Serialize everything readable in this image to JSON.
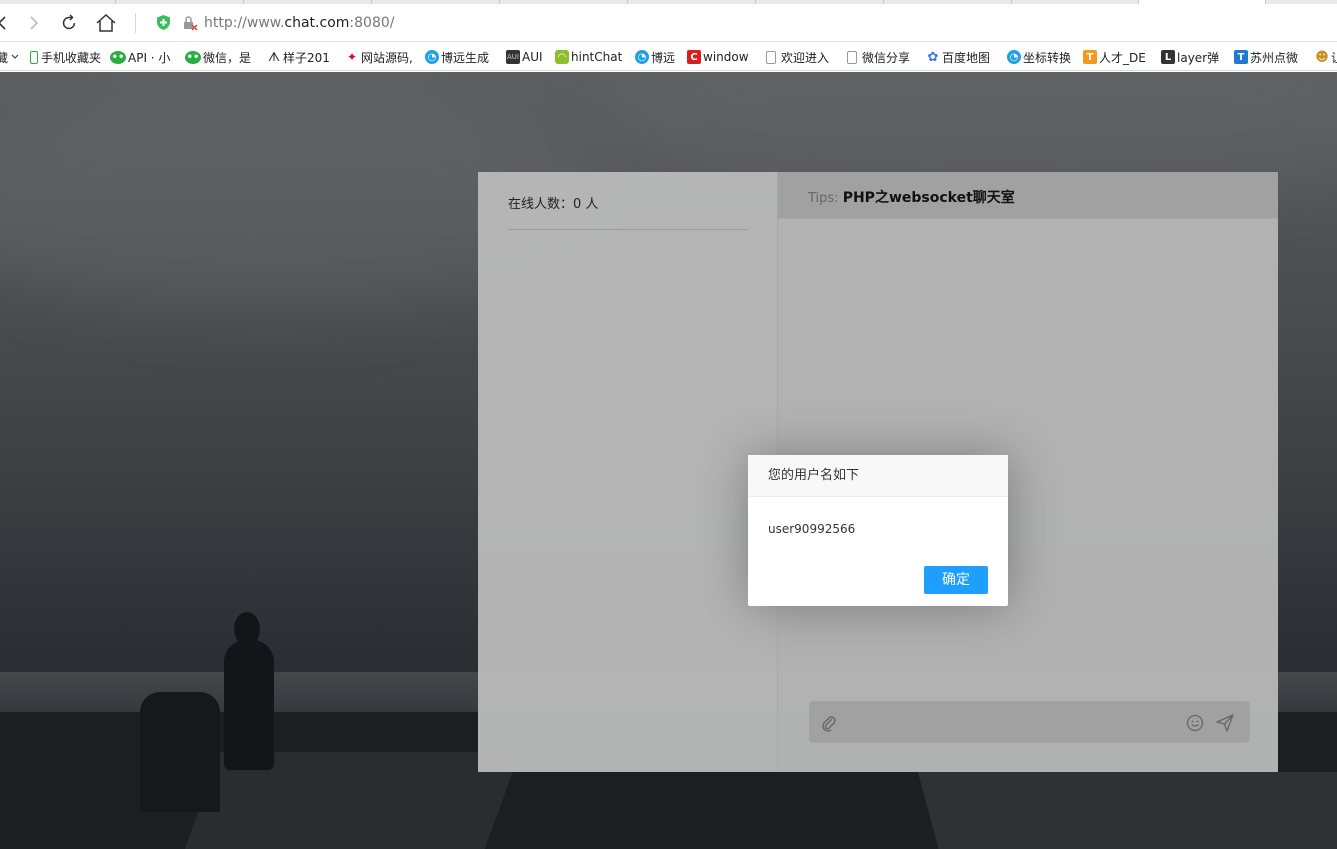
{
  "browser": {
    "url_scheme": "http://www.",
    "url_host": "chat.com",
    "url_rest": ":8080/",
    "bookmarks": [
      {
        "label": "藏",
        "icon": "chevron-down-icon"
      },
      {
        "label": "手机收藏夹",
        "icon": "phone-icon"
      },
      {
        "label": "API · 小",
        "icon": "wechat-icon"
      },
      {
        "label": "微信，是",
        "icon": "wechat-icon"
      },
      {
        "label": "样子201",
        "icon": "logo-icon"
      },
      {
        "label": "网站源码,",
        "icon": "logo-icon"
      },
      {
        "label": "博远生成",
        "icon": "globe-icon"
      },
      {
        "label": "AUI",
        "icon": "aui-icon"
      },
      {
        "label": "hintChat",
        "icon": "hint-icon"
      },
      {
        "label": "博远",
        "icon": "globe-icon"
      },
      {
        "label": "window",
        "icon": "c-icon"
      },
      {
        "label": "欢迎进入",
        "icon": "page-icon"
      },
      {
        "label": "微信分享",
        "icon": "page-icon"
      },
      {
        "label": "百度地图",
        "icon": "baidu-icon"
      },
      {
        "label": "坐标转换",
        "icon": "globe-icon"
      },
      {
        "label": "人才_DE",
        "icon": "talent-icon"
      },
      {
        "label": "layer弹",
        "icon": "layer-icon"
      },
      {
        "label": "苏州点微",
        "icon": "t-icon"
      },
      {
        "label": "让",
        "icon": "person-icon"
      }
    ]
  },
  "chat": {
    "online_label": "在线人数：",
    "online_count": "0 人",
    "tips_prefix": "Tips:",
    "tips_title": "PHP之websocket聊天室",
    "message_placeholder": ""
  },
  "modal": {
    "title": "您的用户名如下",
    "username": "user90992566",
    "confirm_label": "确定"
  },
  "colors": {
    "accent": "#1e9fff",
    "wechat": "#2aae3f",
    "baidu": "#3377ee"
  }
}
